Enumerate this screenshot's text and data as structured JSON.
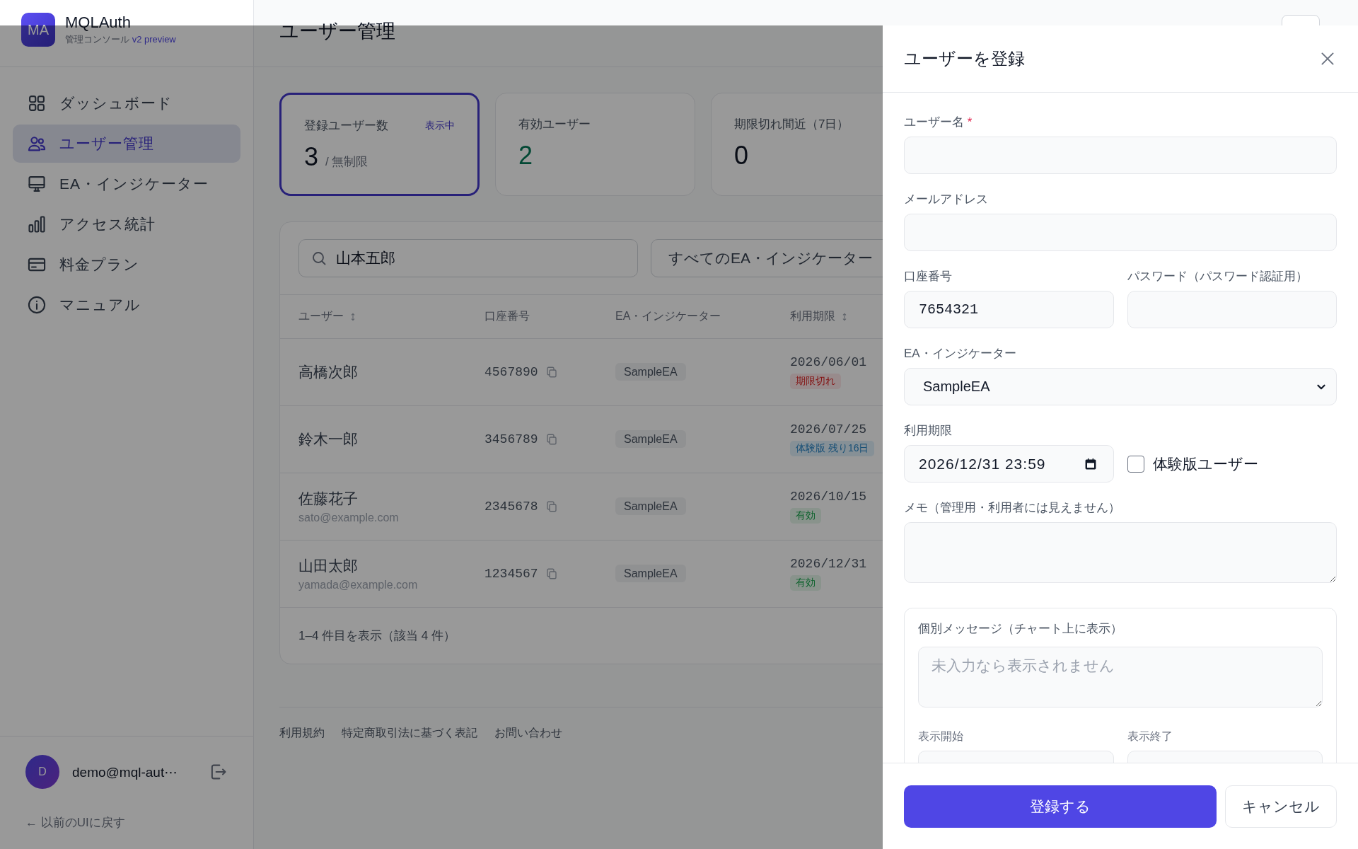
{
  "app": {
    "logo": "MA",
    "name": "MQLAuth",
    "subtitle": "管理コンソール",
    "version": "v2 preview"
  },
  "sidebar": {
    "items": [
      {
        "label": "ダッシュボード",
        "selected": false
      },
      {
        "label": "ユーザー管理",
        "selected": true
      },
      {
        "label": "EA・インジケーター",
        "selected": false
      },
      {
        "label": "アクセス統計",
        "selected": false
      },
      {
        "label": "料金プラン",
        "selected": false
      },
      {
        "label": "マニュアル",
        "selected": false
      }
    ]
  },
  "account": {
    "avatar": "D",
    "email": "demo@mql-aut⋯",
    "back_link": "← 以前のUIに戻す"
  },
  "page_title": "ユーザー管理",
  "stats": [
    {
      "label": "登録ユーザー数",
      "badge": "表示中",
      "value": "3",
      "suffix": "/ 無制限",
      "selected": true,
      "kind": "neutral"
    },
    {
      "label": "有効ユーザー",
      "value": "2",
      "selected": false,
      "kind": "positive"
    },
    {
      "label": "期限切れ間近（7日）",
      "value": "0",
      "selected": false,
      "kind": "neutral"
    }
  ],
  "search": {
    "value": "山本五郎"
  },
  "filter": {
    "value": "すべてのEA・インジケーター"
  },
  "table": {
    "columns": [
      {
        "label": "ユーザー",
        "sortable": true
      },
      {
        "label": "口座番号",
        "sortable": false
      },
      {
        "label": "EA・インジケーター",
        "sortable": false
      },
      {
        "label": "利用期限",
        "sortable": true
      }
    ],
    "rows": [
      {
        "name": "高橋次郎",
        "account": "4567890",
        "ea": "SampleEA",
        "expiry": "2026/06/01",
        "status": {
          "label": "期限切れ",
          "kind": "expired"
        }
      },
      {
        "name": "鈴木一郎",
        "account": "3456789",
        "ea": "SampleEA",
        "expiry": "2026/07/25",
        "status": {
          "label": "体験版 残り16日",
          "kind": "trial"
        }
      },
      {
        "name": "佐藤花子",
        "email": "sato@example.com",
        "account": "2345678",
        "ea": "SampleEA",
        "expiry": "2026/10/15",
        "status": {
          "label": "有効",
          "kind": "active"
        }
      },
      {
        "name": "山田太郎",
        "email": "yamada@example.com",
        "account": "1234567",
        "ea": "SampleEA",
        "expiry": "2026/12/31",
        "status": {
          "label": "有効",
          "kind": "active"
        }
      }
    ],
    "summary": "1–4 件目を表示（該当 4 件）"
  },
  "footer_links": [
    "利用規約",
    "特定商取引法に基づく表記",
    "お問い合わせ"
  ],
  "drawer": {
    "title": "ユーザーを登録",
    "rows": [
      [
        {
          "kind": "text",
          "label": "ユーザー名",
          "required_mark": "*"
        }
      ],
      [
        {
          "kind": "text",
          "label": "メールアドレス"
        }
      ],
      [
        {
          "kind": "number",
          "label": "口座番号",
          "value": "7654321"
        },
        {
          "kind": "password",
          "label": "パスワード（パスワード認証用）"
        }
      ],
      [
        {
          "kind": "select",
          "label": "EA・インジケーター",
          "value": "SampleEA"
        }
      ],
      [
        {
          "kind": "date",
          "label": "利用期限",
          "value": "2026/12/31 23:59"
        },
        {
          "kind": "checkbox",
          "label": "体験版ユーザー",
          "checked": false
        }
      ],
      [
        {
          "kind": "textarea",
          "label": "メモ（管理用・利用者には見えません）"
        }
      ]
    ],
    "message": {
      "title": "個別メッセージ（チャート上に表示）",
      "placeholder": "未入力なら表示されません",
      "start_label": "表示開始",
      "end_label": "表示終了"
    },
    "submit": "登録する",
    "cancel": "キャンセル"
  }
}
